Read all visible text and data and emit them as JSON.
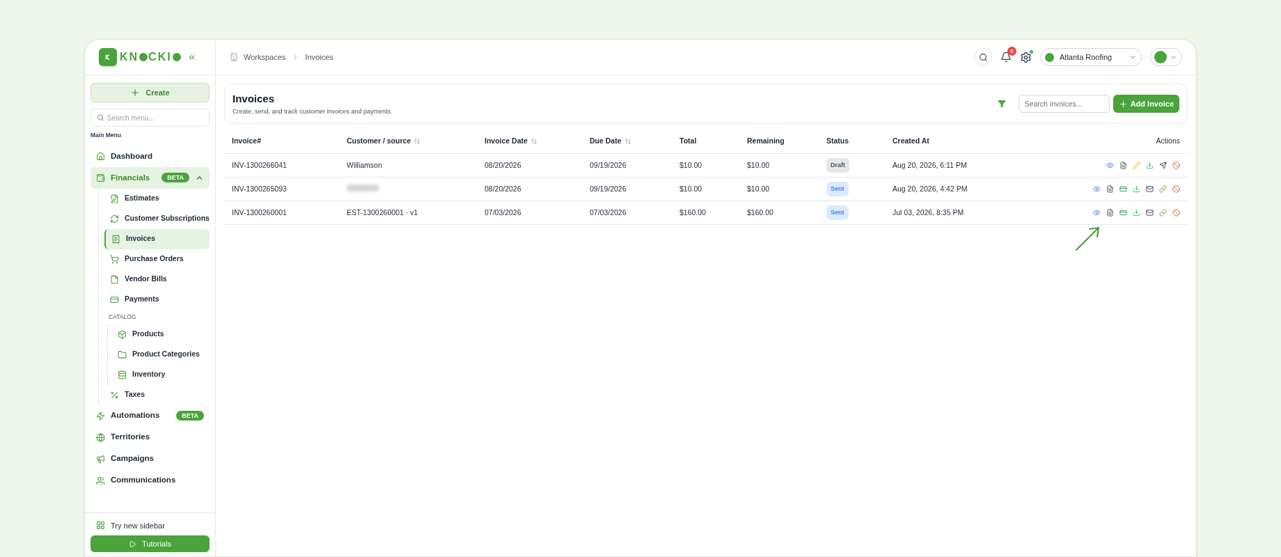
{
  "sidebar": {
    "logo_segments": [
      "KN",
      "CKI"
    ],
    "create_button": "Create",
    "search": {
      "placeholder": "Search menu..."
    },
    "section_label": "Main Menu",
    "items": [
      {
        "label": "Dashboard",
        "selected": false
      },
      {
        "label": "Financials",
        "badge": "BETA",
        "expanded": true,
        "selected": false,
        "children": [
          {
            "label": "Estimates",
            "selected": false
          },
          {
            "label": "Customer Subscriptions",
            "selected": false
          },
          {
            "label": "Invoices",
            "selected": true
          },
          {
            "label": "Purchase Orders",
            "selected": false
          },
          {
            "label": "Vendor Bills",
            "selected": false
          },
          {
            "label": "Payments",
            "selected": false
          },
          {
            "kind": "group",
            "label": "CATALOG",
            "children": [
              {
                "label": "Products",
                "selected": false
              },
              {
                "label": "Product Categories",
                "selected": false
              },
              {
                "label": "Inventory",
                "selected": false
              }
            ]
          },
          {
            "label": "Taxes",
            "selected": false
          }
        ]
      },
      {
        "label": "Automations",
        "badge": "BETA",
        "selected": false
      },
      {
        "label": "Territories",
        "selected": false
      },
      {
        "label": "Campaigns",
        "selected": false
      },
      {
        "label": "Communications",
        "selected": false
      }
    ],
    "footer": {
      "link": "Try new sidebar",
      "button": "Tutorials"
    }
  },
  "header": {
    "breadcrumb": [
      "Workspaces",
      "Invoices"
    ],
    "notification_count": "6",
    "workspace": "Atlanta Roofing"
  },
  "page": {
    "title": "Invoices",
    "subtitle": "Create, send, and track customer invoices and payments.",
    "search": {
      "placeholder": "Search invoices..."
    },
    "add_button": "Add Invoice"
  },
  "table": {
    "columns": [
      {
        "label": "Invoice#",
        "sortable": false
      },
      {
        "label": "Customer / source",
        "sortable": true
      },
      {
        "label": "Invoice Date",
        "sortable": true
      },
      {
        "label": "Due Date",
        "sortable": true
      },
      {
        "label": "Total",
        "sortable": false
      },
      {
        "label": "Remaining",
        "sortable": false
      },
      {
        "label": "Status",
        "sortable": false
      },
      {
        "label": "Created At",
        "sortable": false
      },
      {
        "label": "Actions",
        "sortable": false
      }
    ],
    "rows": [
      {
        "invoice": "INV-1300266041",
        "customer": "Williamson",
        "invoice_date": "08/20/2026",
        "due_date": "09/19/2026",
        "total": "$10.00",
        "remaining": "$10.00",
        "status": {
          "label": "Draft",
          "kind": "draft"
        },
        "created_at": "Aug 20, 2026, 6:11 PM",
        "actions": [
          {
            "kind": "view"
          },
          {
            "kind": "pdf"
          },
          {
            "kind": "edit"
          },
          {
            "kind": "download"
          },
          {
            "kind": "send"
          },
          {
            "kind": "cancel"
          }
        ],
        "pointer": false
      },
      {
        "invoice": "INV-1300265093",
        "invoice_date": "08/20/2026",
        "due_date": "09/19/2026",
        "total": "$10.00",
        "remaining": "$10.00",
        "status": {
          "label": "Sent",
          "kind": "sent"
        },
        "created_at": "Aug 20, 2026, 4:42 PM",
        "actions": [
          {
            "kind": "view"
          },
          {
            "kind": "pdf"
          },
          {
            "kind": "payment"
          },
          {
            "kind": "download"
          },
          {
            "kind": "email"
          },
          {
            "kind": "link"
          },
          {
            "kind": "cancel"
          }
        ],
        "pointer": false
      },
      {
        "invoice": "INV-1300260001",
        "customer": "EST-1300260001 · v1",
        "invoice_date": "07/03/2026",
        "due_date": "07/03/2026",
        "total": "$160.00",
        "remaining": "$160.00",
        "status": {
          "label": "Sent",
          "kind": "sent"
        },
        "created_at": "Jul 03, 2026, 8:35 PM",
        "actions": [
          {
            "kind": "view"
          },
          {
            "kind": "pdf"
          },
          {
            "kind": "payment"
          },
          {
            "kind": "download"
          },
          {
            "kind": "email"
          },
          {
            "kind": "link"
          },
          {
            "kind": "cancel"
          }
        ],
        "pointer": true
      }
    ]
  }
}
